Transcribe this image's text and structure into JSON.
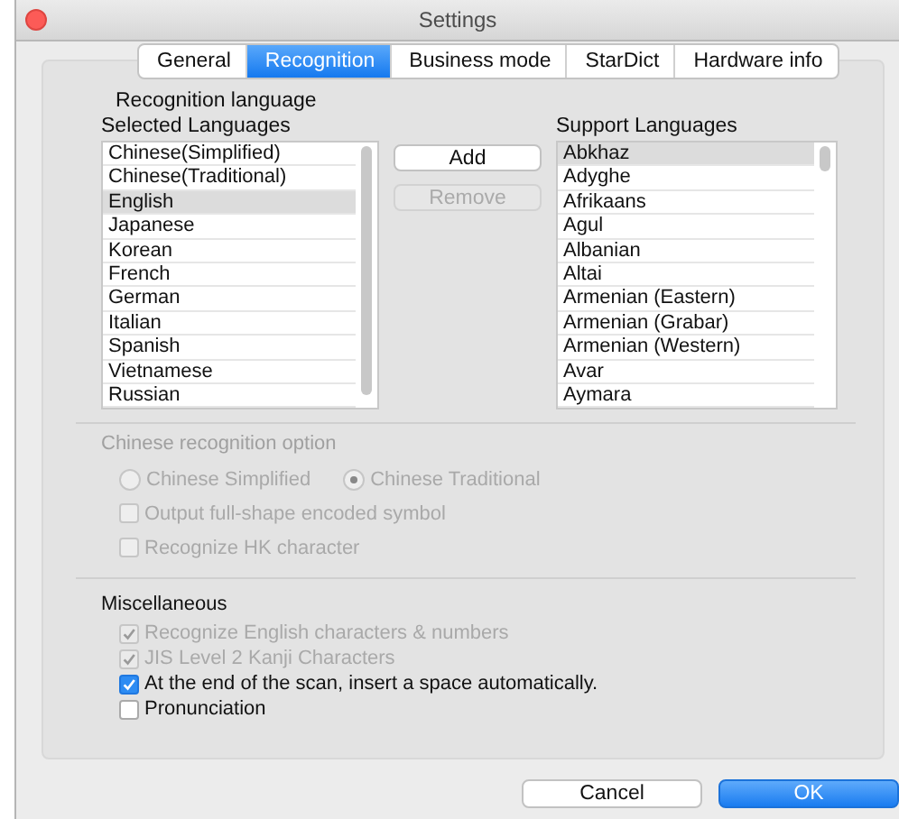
{
  "window": {
    "title": "Settings"
  },
  "tabs": [
    {
      "label": "General",
      "selected": false
    },
    {
      "label": "Recognition",
      "selected": true
    },
    {
      "label": "Business mode",
      "selected": false
    },
    {
      "label": "StarDict",
      "selected": false
    },
    {
      "label": "Hardware info",
      "selected": false
    }
  ],
  "recognition_language": {
    "heading": "Recognition language",
    "selected_languages": {
      "label": "Selected Languages",
      "items": [
        {
          "text": "Chinese(Simplified)",
          "selected": false
        },
        {
          "text": "Chinese(Traditional)",
          "selected": false
        },
        {
          "text": "English",
          "selected": true
        },
        {
          "text": "Japanese",
          "selected": false
        },
        {
          "text": "Korean",
          "selected": false
        },
        {
          "text": "French",
          "selected": false
        },
        {
          "text": "German",
          "selected": false
        },
        {
          "text": "Italian",
          "selected": false
        },
        {
          "text": "Spanish",
          "selected": false
        },
        {
          "text": "Vietnamese",
          "selected": false
        },
        {
          "text": "Russian",
          "selected": false
        }
      ]
    },
    "actions": [
      {
        "label": "Add",
        "disabled": false
      },
      {
        "label": "Remove",
        "disabled": true
      }
    ],
    "support_languages": {
      "label": "Support Languages",
      "items": [
        {
          "text": "Abkhaz",
          "selected": true
        },
        {
          "text": "Adyghe",
          "selected": false
        },
        {
          "text": "Afrikaans",
          "selected": false
        },
        {
          "text": "Agul",
          "selected": false
        },
        {
          "text": "Albanian",
          "selected": false
        },
        {
          "text": "Altai",
          "selected": false
        },
        {
          "text": "Armenian (Eastern)",
          "selected": false
        },
        {
          "text": "Armenian (Grabar)",
          "selected": false
        },
        {
          "text": "Armenian (Western)",
          "selected": false
        },
        {
          "text": "Avar",
          "selected": false
        },
        {
          "text": "Aymara",
          "selected": false
        }
      ]
    }
  },
  "chinese_option": {
    "heading": "Chinese recognition option",
    "disabled": true,
    "radios": [
      {
        "label": "Chinese Simplified",
        "selected": false
      },
      {
        "label": "Chinese Traditional",
        "selected": true
      }
    ],
    "checkboxes": [
      {
        "label": "Output full-shape encoded symbol",
        "checked": false
      },
      {
        "label": "Recognize HK character",
        "checked": false
      }
    ]
  },
  "miscellaneous": {
    "heading": "Miscellaneous",
    "checkboxes": [
      {
        "label": "Recognize English characters & numbers",
        "checked": true,
        "disabled": true
      },
      {
        "label": "JIS Level 2 Kanji Characters",
        "checked": true,
        "disabled": true
      },
      {
        "label": "At the end of the scan, insert a space automatically.",
        "checked": true,
        "disabled": false
      },
      {
        "label": "Pronunciation",
        "checked": false,
        "disabled": false
      }
    ]
  },
  "buttons": [
    {
      "label": "Cancel",
      "kind": "normal"
    },
    {
      "label": "OK",
      "kind": "default"
    }
  ]
}
